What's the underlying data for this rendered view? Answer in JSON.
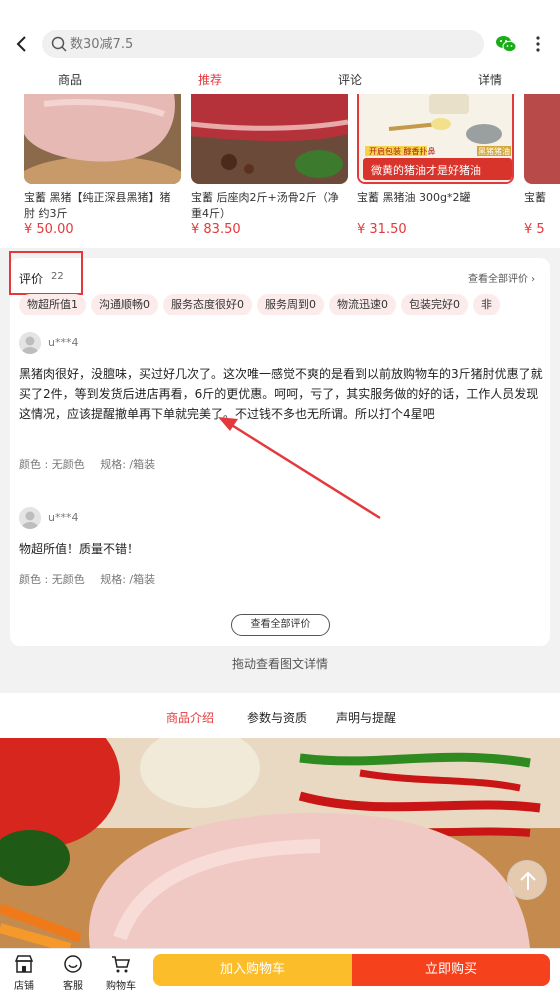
{
  "search": {
    "placeholder": "数30减7.5"
  },
  "tabs": [
    {
      "label": "商品"
    },
    {
      "label": "推荐"
    },
    {
      "label": "评论"
    },
    {
      "label": "详情"
    }
  ],
  "recommendations": [
    {
      "title": "宝蓄 黑猪【纯正深县黑猪】猪肘 约3斤",
      "price": "¥ 50.00"
    },
    {
      "title": "宝蓄 后座肉2斤+汤骨2斤（净重4斤）",
      "price": "¥ 83.50"
    },
    {
      "title": "宝蓄 黑猪油 300g*2罐",
      "price": "¥ 31.50",
      "banner_top": "开启包装 醇香扑鼻",
      "banner_badge": "黑猪猪油",
      "banner_main": "微黄的猪油才是好猪油"
    },
    {
      "title": "宝蓄",
      "price": "¥ 5"
    }
  ],
  "reviews": {
    "title": "评价",
    "count": "22",
    "view_all_top": "查看全部评价 ›",
    "tags": [
      "物超所值1",
      "沟通顺畅0",
      "服务态度很好0",
      "服务周到0",
      "物流迅速0",
      "包装完好0",
      "非"
    ],
    "items": [
      {
        "user": "u***4",
        "text": "黑猪肉很好，没膻味，买过好几次了。这次唯一感觉不爽的是看到以前放购物车的3斤猪肘优惠了就买了2件，等到发货后进店再看，6斤的更优惠。呵呵，亏了，其实服务做的好的话，工作人员发现这情况，应该提醒撤单再下单就完美了。不过钱不多也无所谓。所以打个4星吧",
        "color": "颜色 : 无颜色",
        "spec": "规格: /箱装"
      },
      {
        "user": "u***4",
        "text": "物超所值！质量不错！",
        "color": "颜色 : 无颜色",
        "spec": "规格: /箱装"
      }
    ],
    "view_all_button": "查看全部评价"
  },
  "drag_tip": "拖动查看图文详情",
  "detail_tabs": [
    {
      "label": "商品介绍"
    },
    {
      "label": "参数与资质"
    },
    {
      "label": "声明与提醒"
    }
  ],
  "bottom": {
    "store": "店铺",
    "service": "客服",
    "cart": "购物车",
    "add_to_cart": "加入购物车",
    "buy_now": "立即购买"
  },
  "colors": {
    "accent": "#e4393c",
    "cart_button": "#fbbd2a",
    "buy_button": "#f5421d"
  }
}
